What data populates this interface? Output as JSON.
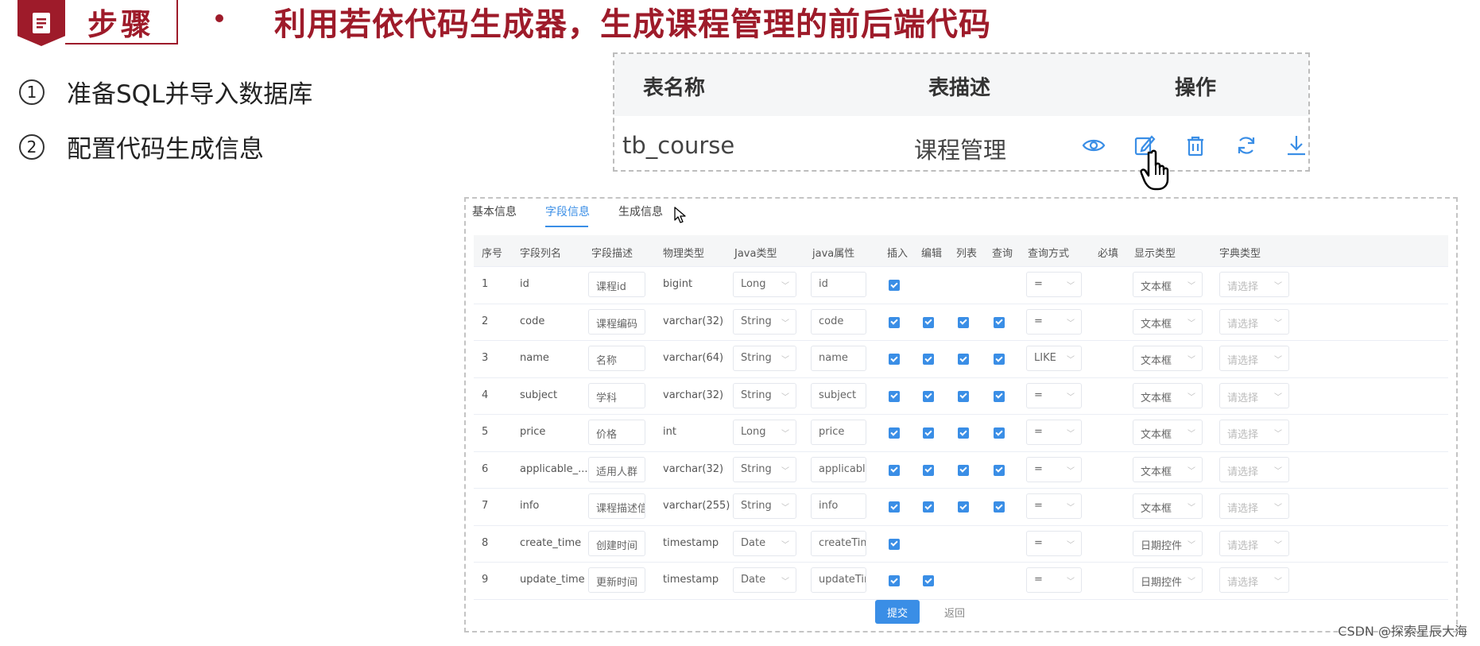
{
  "header": {
    "step_label": "步骤",
    "title": "利用若依代码生成器，生成课程管理的前后端代码"
  },
  "steps": [
    {
      "num": "1",
      "text": "准备SQL并导入数据库"
    },
    {
      "num": "2",
      "text": "配置代码生成信息"
    }
  ],
  "top_table": {
    "columns": [
      "表名称",
      "表描述",
      "操作"
    ],
    "row": {
      "name": "tb_course",
      "desc": "课程管理"
    },
    "actions": [
      "view-icon",
      "edit-icon",
      "delete-icon",
      "sync-icon",
      "download-icon"
    ]
  },
  "tabs": [
    "基本信息",
    "字段信息",
    "生成信息"
  ],
  "active_tab": "字段信息",
  "columns": [
    "序号",
    "字段列名",
    "字段描述",
    "物理类型",
    "Java类型",
    "java属性",
    "插入",
    "编辑",
    "列表",
    "查询",
    "查询方式",
    "必填",
    "显示类型",
    "字典类型"
  ],
  "rows": [
    {
      "no": "1",
      "col": "id",
      "desc": "课程id",
      "phys": "bigint",
      "jtype": "Long",
      "jprop": "id",
      "ins": true,
      "edit": false,
      "list": false,
      "query": false,
      "qmode": "=",
      "display": "文本框",
      "dict": "请选择"
    },
    {
      "no": "2",
      "col": "code",
      "desc": "课程编码",
      "phys": "varchar(32)",
      "jtype": "String",
      "jprop": "code",
      "ins": true,
      "edit": true,
      "list": true,
      "query": true,
      "qmode": "=",
      "display": "文本框",
      "dict": "请选择"
    },
    {
      "no": "3",
      "col": "name",
      "desc": "名称",
      "phys": "varchar(64)",
      "jtype": "String",
      "jprop": "name",
      "ins": true,
      "edit": true,
      "list": true,
      "query": true,
      "qmode": "LIKE",
      "display": "文本框",
      "dict": "请选择"
    },
    {
      "no": "4",
      "col": "subject",
      "desc": "学科",
      "phys": "varchar(32)",
      "jtype": "String",
      "jprop": "subject",
      "ins": true,
      "edit": true,
      "list": true,
      "query": true,
      "qmode": "=",
      "display": "文本框",
      "dict": "请选择"
    },
    {
      "no": "5",
      "col": "price",
      "desc": "价格",
      "phys": "int",
      "jtype": "Long",
      "jprop": "price",
      "ins": true,
      "edit": true,
      "list": true,
      "query": true,
      "qmode": "=",
      "display": "文本框",
      "dict": "请选择"
    },
    {
      "no": "6",
      "col": "applicable_...",
      "desc": "适用人群",
      "phys": "varchar(32)",
      "jtype": "String",
      "jprop": "applicablel",
      "ins": true,
      "edit": true,
      "list": true,
      "query": true,
      "qmode": "=",
      "display": "文本框",
      "dict": "请选择"
    },
    {
      "no": "7",
      "col": "info",
      "desc": "课程描述信",
      "phys": "varchar(255)",
      "jtype": "String",
      "jprop": "info",
      "ins": true,
      "edit": true,
      "list": true,
      "query": true,
      "qmode": "=",
      "display": "文本框",
      "dict": "请选择"
    },
    {
      "no": "8",
      "col": "create_time",
      "desc": "创建时间",
      "phys": "timestamp",
      "jtype": "Date",
      "jprop": "createTime",
      "ins": true,
      "edit": false,
      "list": false,
      "query": false,
      "qmode": "=",
      "display": "日期控件",
      "dict": "请选择"
    },
    {
      "no": "9",
      "col": "update_time",
      "desc": "更新时间",
      "phys": "timestamp",
      "jtype": "Date",
      "jprop": "updateTim",
      "ins": true,
      "edit": true,
      "list": false,
      "query": false,
      "qmode": "=",
      "display": "日期控件",
      "dict": "请选择"
    }
  ],
  "buttons": {
    "submit": "提交",
    "back": "返回"
  },
  "watermark": "CSDN @探索星辰大海",
  "colors": {
    "brand": "#9e1b2a",
    "accent": "#3a8ee6"
  }
}
